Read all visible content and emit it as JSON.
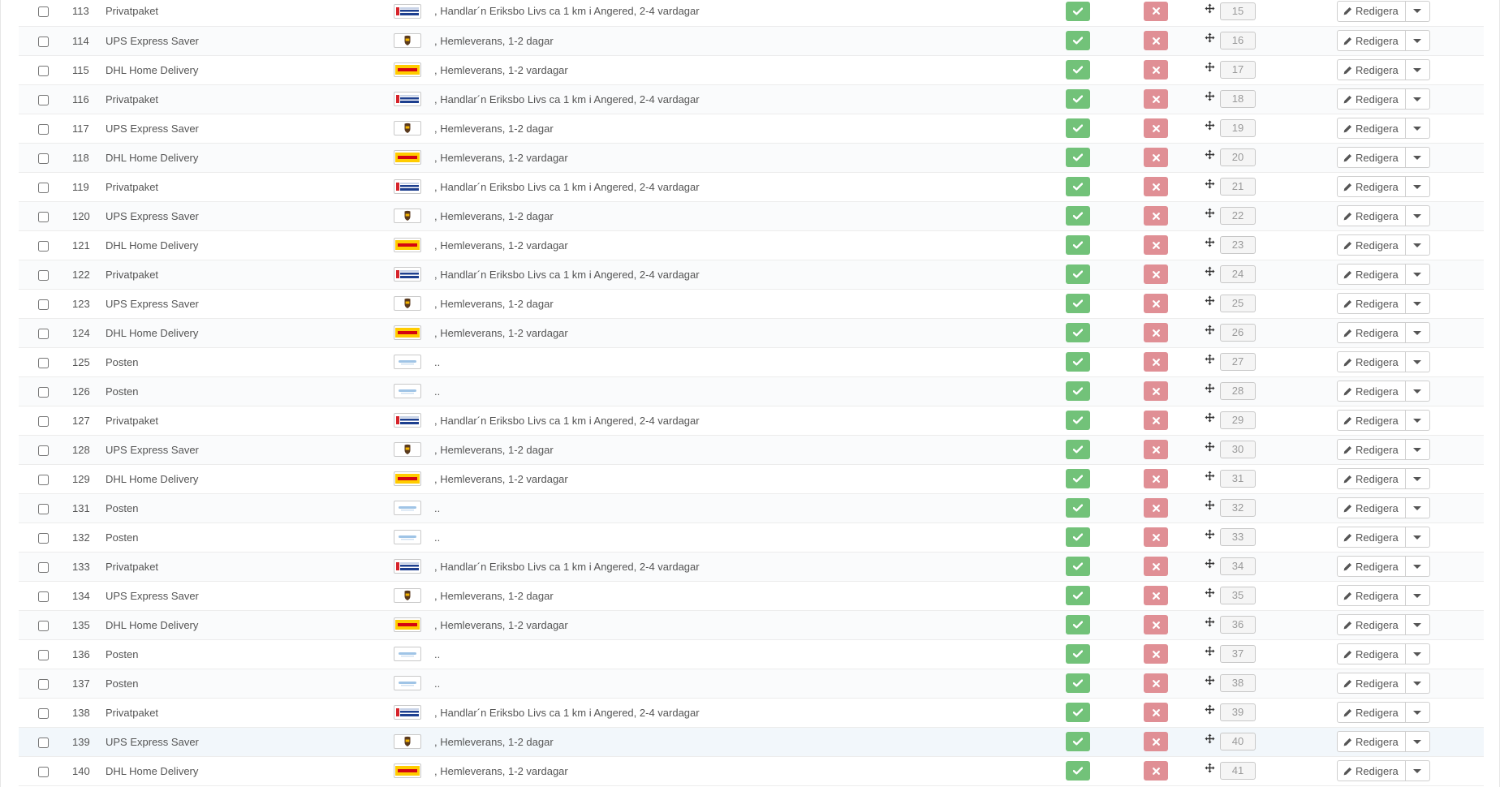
{
  "table": {
    "edit_label": "Redigera",
    "status_colors": {
      "enabled": "#72c279",
      "disabled": "#e08f95"
    },
    "rows": [
      {
        "id": "113",
        "name": "Privatpaket",
        "logo": "schenker-logo",
        "desc": ", Handlar´n Eriksbo Livs ca 1 km i Angered, 2-4 vardagar",
        "position": "15"
      },
      {
        "id": "114",
        "name": "UPS Express Saver",
        "logo": "ups-logo",
        "desc": ", Hemleverans, 1-2 dagar",
        "position": "16"
      },
      {
        "id": "115",
        "name": "DHL Home Delivery",
        "logo": "dhl-logo",
        "desc": ", Hemleverans, 1-2 vardagar",
        "position": "17"
      },
      {
        "id": "116",
        "name": "Privatpaket",
        "logo": "schenker-logo",
        "desc": ", Handlar´n Eriksbo Livs ca 1 km i Angered, 2-4 vardagar",
        "position": "18"
      },
      {
        "id": "117",
        "name": "UPS Express Saver",
        "logo": "ups-logo",
        "desc": ", Hemleverans, 1-2 dagar",
        "position": "19"
      },
      {
        "id": "118",
        "name": "DHL Home Delivery",
        "logo": "dhl-logo",
        "desc": ", Hemleverans, 1-2 vardagar",
        "position": "20"
      },
      {
        "id": "119",
        "name": "Privatpaket",
        "logo": "schenker-logo",
        "desc": ", Handlar´n Eriksbo Livs ca 1 km i Angered, 2-4 vardagar",
        "position": "21"
      },
      {
        "id": "120",
        "name": "UPS Express Saver",
        "logo": "ups-logo",
        "desc": ", Hemleverans, 1-2 dagar",
        "position": "22"
      },
      {
        "id": "121",
        "name": "DHL Home Delivery",
        "logo": "dhl-logo",
        "desc": ", Hemleverans, 1-2 vardagar",
        "position": "23"
      },
      {
        "id": "122",
        "name": "Privatpaket",
        "logo": "schenker-logo",
        "desc": ", Handlar´n Eriksbo Livs ca 1 km i Angered, 2-4 vardagar",
        "position": "24"
      },
      {
        "id": "123",
        "name": "UPS Express Saver",
        "logo": "ups-logo",
        "desc": ", Hemleverans, 1-2 dagar",
        "position": "25"
      },
      {
        "id": "124",
        "name": "DHL Home Delivery",
        "logo": "dhl-logo",
        "desc": ", Hemleverans, 1-2 vardagar",
        "position": "26"
      },
      {
        "id": "125",
        "name": "Posten",
        "logo": "posten-logo",
        "desc": "..",
        "position": "27"
      },
      {
        "id": "126",
        "name": "Posten",
        "logo": "posten-logo",
        "desc": "..",
        "position": "28"
      },
      {
        "id": "127",
        "name": "Privatpaket",
        "logo": "schenker-logo",
        "desc": ", Handlar´n Eriksbo Livs ca 1 km i Angered, 2-4 vardagar",
        "position": "29"
      },
      {
        "id": "128",
        "name": "UPS Express Saver",
        "logo": "ups-logo",
        "desc": ", Hemleverans, 1-2 dagar",
        "position": "30"
      },
      {
        "id": "129",
        "name": "DHL Home Delivery",
        "logo": "dhl-logo",
        "desc": ", Hemleverans, 1-2 vardagar",
        "position": "31"
      },
      {
        "id": "131",
        "name": "Posten",
        "logo": "posten-logo",
        "desc": "..",
        "position": "32"
      },
      {
        "id": "132",
        "name": "Posten",
        "logo": "posten-logo",
        "desc": "..",
        "position": "33"
      },
      {
        "id": "133",
        "name": "Privatpaket",
        "logo": "schenker-logo",
        "desc": ", Handlar´n Eriksbo Livs ca 1 km i Angered, 2-4 vardagar",
        "position": "34"
      },
      {
        "id": "134",
        "name": "UPS Express Saver",
        "logo": "ups-logo",
        "desc": ", Hemleverans, 1-2 dagar",
        "position": "35"
      },
      {
        "id": "135",
        "name": "DHL Home Delivery",
        "logo": "dhl-logo",
        "desc": ", Hemleverans, 1-2 vardagar",
        "position": "36"
      },
      {
        "id": "136",
        "name": "Posten",
        "logo": "posten-logo",
        "desc": "..",
        "position": "37"
      },
      {
        "id": "137",
        "name": "Posten",
        "logo": "posten-logo",
        "desc": "..",
        "position": "38"
      },
      {
        "id": "138",
        "name": "Privatpaket",
        "logo": "schenker-logo",
        "desc": ", Handlar´n Eriksbo Livs ca 1 km i Angered, 2-4 vardagar",
        "position": "39"
      },
      {
        "id": "139",
        "name": "UPS Express Saver",
        "logo": "ups-logo",
        "desc": ", Hemleverans, 1-2 dagar",
        "position": "40",
        "highlight": true
      },
      {
        "id": "140",
        "name": "DHL Home Delivery",
        "logo": "dhl-logo",
        "desc": ", Hemleverans, 1-2 vardagar",
        "position": "41"
      }
    ]
  }
}
